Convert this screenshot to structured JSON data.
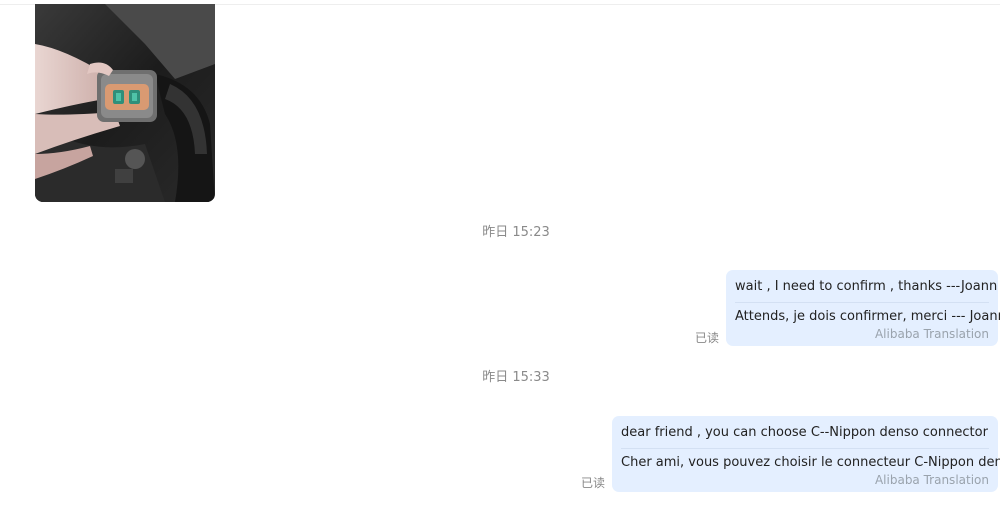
{
  "messages": [
    {
      "type": "image",
      "sender": "other",
      "image_alt": "photo of a grey electrical connector held in a hand in an engine bay"
    },
    {
      "type": "timestamp",
      "text": "昨日 15:23"
    },
    {
      "type": "text",
      "sender": "self",
      "original": "wait , I need to confirm , thanks ---Joann",
      "translation": "Attends, je dois confirmer, merci --- Joann",
      "translation_source": "Alibaba Translation",
      "read_status": "已读"
    },
    {
      "type": "timestamp",
      "text": "昨日 15:33"
    },
    {
      "type": "text",
      "sender": "self",
      "original": "dear friend , you can choose C--Nippon denso connector",
      "translation": "Cher ami, vous pouvez choisir le connecteur C-Nippon denso",
      "translation_source": "Alibaba Translation",
      "read_status": "已读"
    }
  ],
  "colors": {
    "bubble_bg": "#e4efff",
    "timestamp_text": "#8a8a8a",
    "translation_source_text": "#9aa3ad"
  }
}
